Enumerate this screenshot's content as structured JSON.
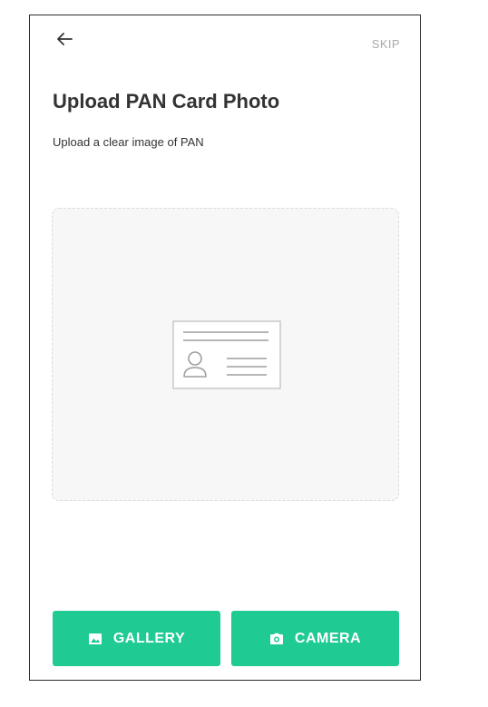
{
  "header": {
    "back_icon": "arrow-left-icon",
    "skip_label": "SKIP"
  },
  "content": {
    "title": "Upload PAN Card Photo",
    "subtitle": "Upload a clear image of PAN"
  },
  "upload_area": {
    "placeholder_icon": "id-card-icon"
  },
  "actions": {
    "gallery_label": "GALLERY",
    "gallery_icon": "image-icon",
    "camera_label": "CAMERA",
    "camera_icon": "camera-icon"
  },
  "colors": {
    "accent": "#1fca93",
    "text_primary": "#333333",
    "text_muted": "#a9a9a9",
    "dropzone_bg": "#f7f7f7"
  }
}
